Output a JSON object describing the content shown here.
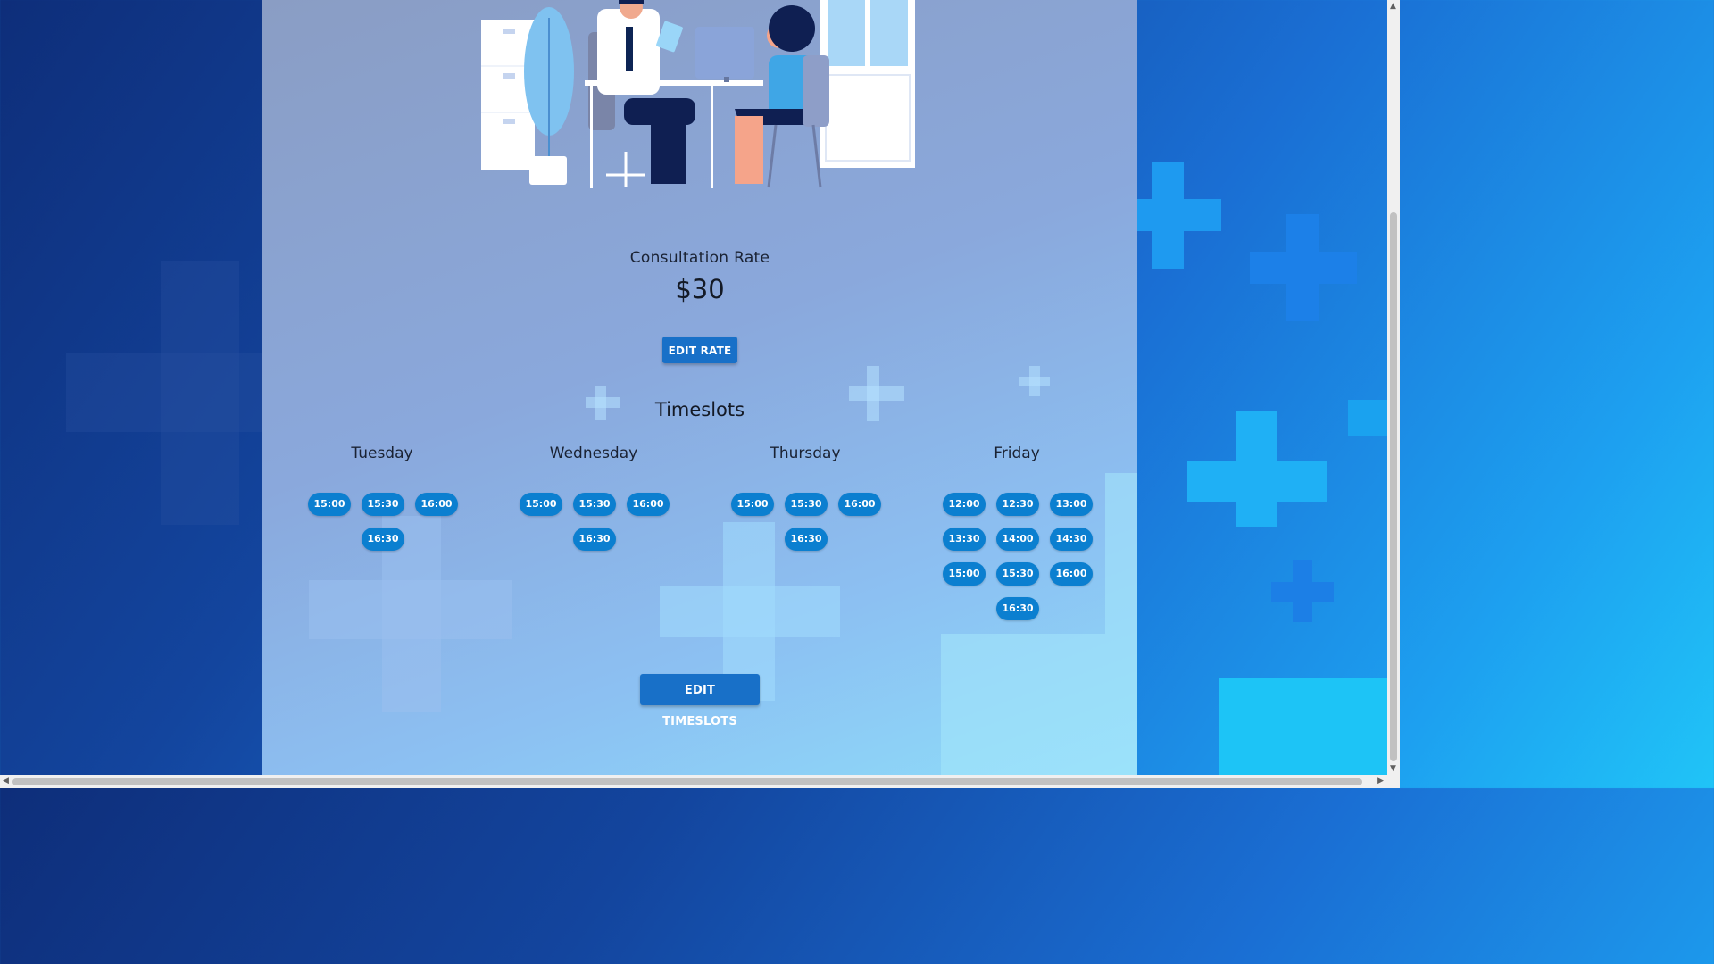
{
  "consultation": {
    "label": "Consultation Rate",
    "value": "$30",
    "edit_label": "EDIT RATE"
  },
  "timeslots": {
    "title": "Timeslots",
    "edit_label": "EDIT TIMESLOTS",
    "days": [
      {
        "name": "Tuesday",
        "slots": [
          "15:00",
          "15:30",
          "16:00",
          "16:30"
        ]
      },
      {
        "name": "Wednesday",
        "slots": [
          "15:00",
          "15:30",
          "16:00",
          "16:30"
        ]
      },
      {
        "name": "Thursday",
        "slots": [
          "15:00",
          "15:30",
          "16:00",
          "16:30"
        ]
      },
      {
        "name": "Friday",
        "slots": [
          "12:00",
          "12:30",
          "13:00",
          "13:30",
          "14:00",
          "14:30",
          "15:00",
          "15:30",
          "16:00",
          "16:30"
        ]
      }
    ]
  },
  "colors": {
    "button": "#1870c8",
    "slot": "#0b7fd0"
  },
  "icons": {
    "illustration": "doctor-consultation-illustration",
    "background": "medical-cross-pattern"
  }
}
